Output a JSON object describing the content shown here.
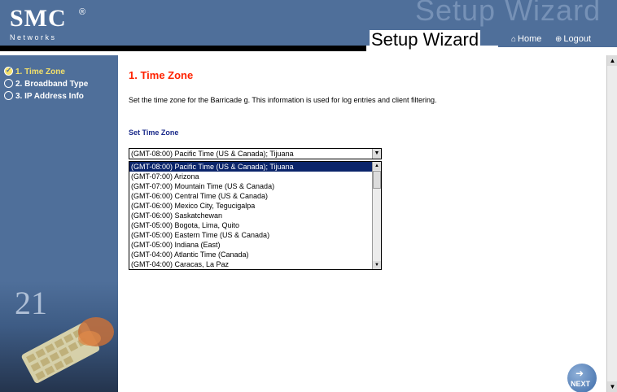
{
  "header": {
    "logo": "SMC",
    "logo_mark": "®",
    "logo_sub": "Networks",
    "watermark": "Setup Wizard",
    "title": "Setup Wizard",
    "home_label": "Home",
    "logout_label": "Logout"
  },
  "sidebar": {
    "steps": [
      {
        "label": "1. Time Zone",
        "active": true
      },
      {
        "label": "2. Broadband Type",
        "active": false
      },
      {
        "label": "3. IP Address Info",
        "active": false
      }
    ]
  },
  "main": {
    "heading": "1. Time Zone",
    "description": "Set the time zone for the Barricade g. This information is used for log entries and client filtering.",
    "section_label": "Set Time Zone",
    "selected_value": "(GMT-08:00) Pacific Time (US & Canada); Tijuana",
    "options": [
      "(GMT-08:00) Pacific Time (US & Canada); Tijuana",
      "(GMT-07:00) Arizona",
      "(GMT-07:00) Mountain Time (US & Canada)",
      "(GMT-06:00) Central Time (US & Canada)",
      "(GMT-06:00) Mexico City, Tegucigalpa",
      "(GMT-06:00) Saskatchewan",
      "(GMT-05:00) Bogota, Lima, Quito",
      "(GMT-05:00) Eastern Time (US & Canada)",
      "(GMT-05:00) Indiana (East)",
      "(GMT-04:00) Atlantic Time (Canada)",
      "(GMT-04:00) Caracas, La Paz"
    ],
    "next_label": "NEXT"
  },
  "colors": {
    "header_band": "#4f6f9a",
    "heading_red": "#ff2200",
    "section_blue": "#1a2a8a",
    "active_step": "#f2e06b",
    "selected_option": "#0a246a"
  }
}
